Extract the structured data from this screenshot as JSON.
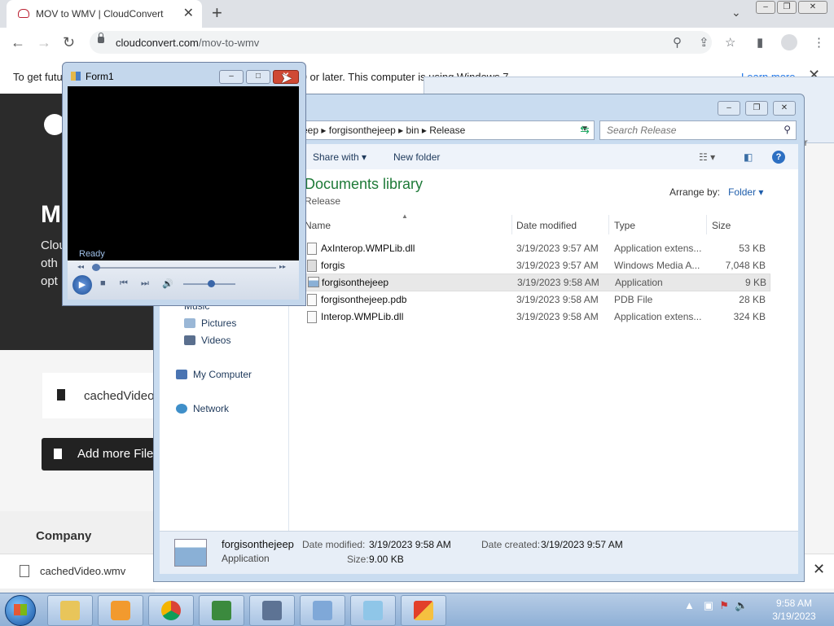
{
  "browser": {
    "tab_title": "MOV to WMV | CloudConvert",
    "url_host": "cloudconvert.com",
    "url_path": "/mov-to-wmv",
    "infobar_message": "To get future Google Chrome updates, you'll need Windows 10 or later. This computer is using Windows 7.",
    "infobar_link": "Learn more"
  },
  "page": {
    "hero_big": "M",
    "hero_lines": [
      "Clou",
      "oth",
      "opt"
    ],
    "file_name": "cachedVideo",
    "add_more_label": "Add more Files",
    "footer_company": "Company"
  },
  "downloads": {
    "file": "cachedVideo.wmv"
  },
  "form1": {
    "title": "Form1",
    "status": "Ready",
    "volume_fraction": 0.5
  },
  "explorer": {
    "breadcrumbs": [
      "eep",
      "forgisonthejeep",
      "bin",
      "Release"
    ],
    "search_placeholder": "Search Release",
    "toolbar": {
      "share_with": "Share with",
      "new_folder": "New folder"
    },
    "nav_items": [
      "Music",
      "Pictures",
      "Videos",
      "My Computer",
      "Network"
    ],
    "library_title": "Documents library",
    "library_subtitle": "Release",
    "arrange_label": "Arrange by:",
    "arrange_value": "Folder",
    "columns": [
      "Name",
      "Date modified",
      "Type",
      "Size"
    ],
    "files": [
      {
        "name": "AxInterop.WMPLib.dll",
        "date": "3/19/2023 9:57 AM",
        "type": "Application extens...",
        "size": "53 KB"
      },
      {
        "name": "forgis",
        "date": "3/19/2023 9:57 AM",
        "type": "Windows Media A...",
        "size": "7,048 KB"
      },
      {
        "name": "forgisonthejeep",
        "date": "3/19/2023 9:58 AM",
        "type": "Application",
        "size": "9 KB"
      },
      {
        "name": "forgisonthejeep.pdb",
        "date": "3/19/2023 9:58 AM",
        "type": "PDB File",
        "size": "28 KB"
      },
      {
        "name": "Interop.WMPLib.dll",
        "date": "3/19/2023 9:58 AM",
        "type": "Application extens...",
        "size": "324 KB"
      }
    ],
    "details": {
      "name": "forgisonthejeep",
      "kind": "Application",
      "date_modified_label": "Date modified:",
      "date_modified": "3/19/2023 9:58 AM",
      "date_created_label": "Date created:",
      "date_created": "3/19/2023 9:57 AM",
      "size_label": "Size:",
      "size": "9.00 KB"
    },
    "background_window_text": "er"
  },
  "taskbar": {
    "time": "9:58 AM",
    "date": "3/19/2023",
    "apps": [
      "windows-explorer-icon",
      "media-player-icon",
      "chrome-icon",
      "visual-studio-csharp-icon",
      "remote-desktop-icon",
      "control-panel-icon",
      "notepad-icon",
      "paint-icon"
    ]
  },
  "colors": {
    "library_green": "#1e7a38",
    "link_blue": "#1a73e8",
    "close_red": "#cf4a35"
  }
}
